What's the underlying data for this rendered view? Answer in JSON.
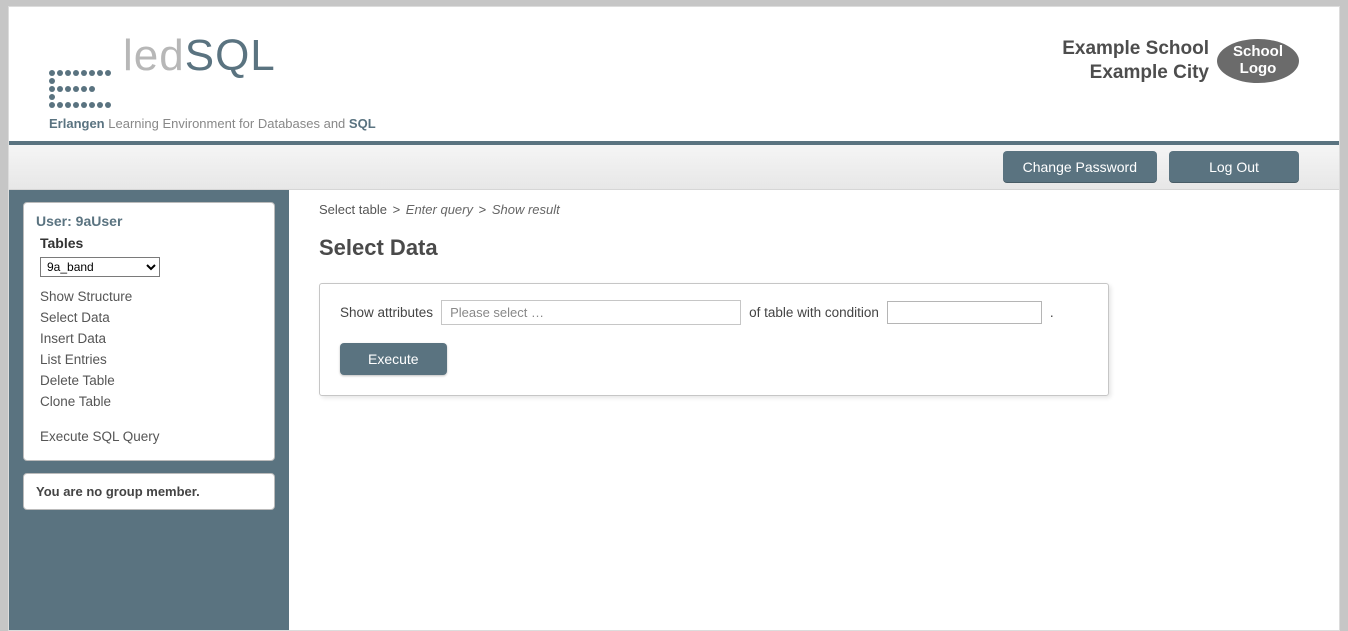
{
  "header": {
    "logo_text_light": "led",
    "logo_text_accent": "SQL",
    "subtitle_strong1": "Erlangen",
    "subtitle_mid": "Learning Environment for Databases and",
    "subtitle_strong2": "SQL",
    "school_line1": "Example School",
    "school_line2": "Example City",
    "school_logo_line1": "School",
    "school_logo_line2": "Logo"
  },
  "toolbar": {
    "change_password": "Change Password",
    "logout": "Log Out"
  },
  "sidebar": {
    "user_label": "User: 9aUser",
    "tables_heading": "Tables",
    "selected_table": "9a_band",
    "links": {
      "show_structure": "Show Structure",
      "select_data": "Select Data",
      "insert_data": "Insert Data",
      "list_entries": "List Entries",
      "delete_table": "Delete Table",
      "clone_table": "Clone Table",
      "execute_sql": "Execute SQL Query"
    },
    "group_message": "You are no group member."
  },
  "breadcrumb": {
    "step1": "Select table",
    "step2": "Enter query",
    "step3": "Show result"
  },
  "main": {
    "page_title": "Select Data",
    "label_show_attributes": "Show attributes",
    "attributes_placeholder": "Please select …",
    "label_of_table_condition": "of table with condition",
    "condition_value": "",
    "period": ".",
    "execute_label": "Execute"
  }
}
